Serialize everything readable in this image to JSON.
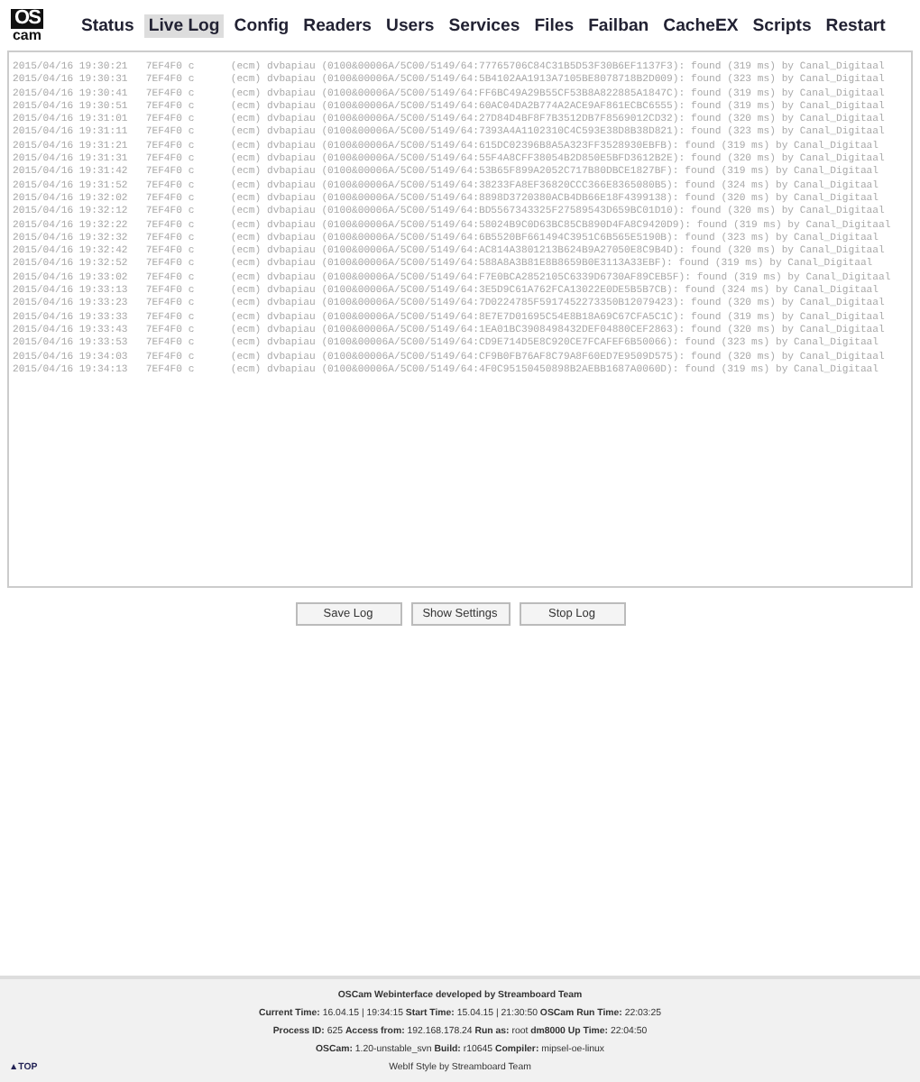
{
  "logo": {
    "top": "OS",
    "bottom": "cam"
  },
  "nav": [
    {
      "label": "Status",
      "selected": false
    },
    {
      "label": "Live Log",
      "selected": true
    },
    {
      "label": "Config",
      "selected": false
    },
    {
      "label": "Readers",
      "selected": false
    },
    {
      "label": "Users",
      "selected": false
    },
    {
      "label": "Services",
      "selected": false
    },
    {
      "label": "Files",
      "selected": false
    },
    {
      "label": "Failban",
      "selected": false
    },
    {
      "label": "CacheEX",
      "selected": false
    },
    {
      "label": "Scripts",
      "selected": false
    },
    {
      "label": "Restart",
      "selected": false
    }
  ],
  "log_lines": [
    "2015/04/16 19:30:21   7EF4F0 c      (ecm) dvbapiau (0100&00006A/5C00/5149/64:77765706C84C31B5D53F30B6EF1137F3): found (319 ms) by Canal_Digitaal",
    "2015/04/16 19:30:31   7EF4F0 c      (ecm) dvbapiau (0100&00006A/5C00/5149/64:5B4102AA1913A7105BE8078718B2D009): found (323 ms) by Canal_Digitaal",
    "2015/04/16 19:30:41   7EF4F0 c      (ecm) dvbapiau (0100&00006A/5C00/5149/64:FF6BC49A29B55CF53B8A822885A1847C): found (319 ms) by Canal_Digitaal",
    "2015/04/16 19:30:51   7EF4F0 c      (ecm) dvbapiau (0100&00006A/5C00/5149/64:60AC04DA2B774A2ACE9AF861ECBC6555): found (319 ms) by Canal_Digitaal",
    "2015/04/16 19:31:01   7EF4F0 c      (ecm) dvbapiau (0100&00006A/5C00/5149/64:27D84D4BF8F7B3512DB7F8569012CD32): found (320 ms) by Canal_Digitaal",
    "2015/04/16 19:31:11   7EF4F0 c      (ecm) dvbapiau (0100&00006A/5C00/5149/64:7393A4A1102310C4C593E38D8B38D821): found (323 ms) by Canal_Digitaal",
    "2015/04/16 19:31:21   7EF4F0 c      (ecm) dvbapiau (0100&00006A/5C00/5149/64:615DC02396B8A5A323FF3528930EBFB): found (319 ms) by Canal_Digitaal",
    "2015/04/16 19:31:31   7EF4F0 c      (ecm) dvbapiau (0100&00006A/5C00/5149/64:55F4A8CFF38054B2D850E5BFD3612B2E): found (320 ms) by Canal_Digitaal",
    "2015/04/16 19:31:42   7EF4F0 c      (ecm) dvbapiau (0100&00006A/5C00/5149/64:53B65F899A2052C717B80DBCE1827BF): found (319 ms) by Canal_Digitaal",
    "2015/04/16 19:31:52   7EF4F0 c      (ecm) dvbapiau (0100&00006A/5C00/5149/64:38233FA8EF36820CCC366E8365080B5): found (324 ms) by Canal_Digitaal",
    "2015/04/16 19:32:02   7EF4F0 c      (ecm) dvbapiau (0100&00006A/5C00/5149/64:8898D3720380ACB4DB66E18F4399138): found (320 ms) by Canal_Digitaal",
    "2015/04/16 19:32:12   7EF4F0 c      (ecm) dvbapiau (0100&00006A/5C00/5149/64:BD5567343325F27589543D659BC01D10): found (320 ms) by Canal_Digitaal",
    "2015/04/16 19:32:22   7EF4F0 c      (ecm) dvbapiau (0100&00006A/5C00/5149/64:58024B9C0D63BC85CB890D4FA8C9420D9): found (319 ms) by Canal_Digitaal",
    "2015/04/16 19:32:32   7EF4F0 c      (ecm) dvbapiau (0100&00006A/5C00/5149/64:6B5520BF661494C3951C6B565E5190B): found (323 ms) by Canal_Digitaal",
    "2015/04/16 19:32:42   7EF4F0 c      (ecm) dvbapiau (0100&00006A/5C00/5149/64:AC814A3801213B624B9A27050E8C9B4D): found (320 ms) by Canal_Digitaal",
    "2015/04/16 19:32:52   7EF4F0 c      (ecm) dvbapiau (0100&00006A/5C00/5149/64:588A8A3B81E8B8659B0E3113A33EBF): found (319 ms) by Canal_Digitaal",
    "2015/04/16 19:33:02   7EF4F0 c      (ecm) dvbapiau (0100&00006A/5C00/5149/64:F7E0BCA2852105C6339D6730AF89CEB5F): found (319 ms) by Canal_Digitaal",
    "2015/04/16 19:33:13   7EF4F0 c      (ecm) dvbapiau (0100&00006A/5C00/5149/64:3E5D9C61A762FCA13022E0DE5B5B7CB): found (324 ms) by Canal_Digitaal",
    "2015/04/16 19:33:23   7EF4F0 c      (ecm) dvbapiau (0100&00006A/5C00/5149/64:7D0224785F5917452273350B12079423): found (320 ms) by Canal_Digitaal",
    "2015/04/16 19:33:33   7EF4F0 c      (ecm) dvbapiau (0100&00006A/5C00/5149/64:8E7E7D01695C54E8B18A69C67CFA5C1C): found (319 ms) by Canal_Digitaal",
    "2015/04/16 19:33:43   7EF4F0 c      (ecm) dvbapiau (0100&00006A/5C00/5149/64:1EA01BC3908498432DEF04880CEF2863): found (320 ms) by Canal_Digitaal",
    "2015/04/16 19:33:53   7EF4F0 c      (ecm) dvbapiau (0100&00006A/5C00/5149/64:CD9E714D5E8C920CE7FCAFEF6B50066): found (323 ms) by Canal_Digitaal",
    "2015/04/16 19:34:03   7EF4F0 c      (ecm) dvbapiau (0100&00006A/5C00/5149/64:CF9B0FB76AF8C79A8F60ED7E9509D575): found (320 ms) by Canal_Digitaal",
    "2015/04/16 19:34:13   7EF4F0 c      (ecm) dvbapiau (0100&00006A/5C00/5149/64:4F0C95150450898B2AEBB1687A0060D): found (319 ms) by Canal_Digitaal"
  ],
  "buttons": [
    "Save Log",
    "Show Settings",
    "Stop Log"
  ],
  "footer": {
    "title": "OSCam Webinterface developed by Streamboard Team",
    "lines": [
      "**Current Time:** 16.04.15 | 19:34:15 **Start Time:** 15.04.15 | 21:30:50 **OSCam Run Time:** 22:03:25",
      "**Process ID:** 625 **Access from:** 192.168.178.24 **Run as:** root **dm8000 Up Time:** 22:04:50",
      "**OSCam:** 1.20-unstable_svn **Build:** r10645 **Compiler:** mipsel-oe-linux"
    ],
    "top_link": "▲TOP",
    "credit": "WebIf Style by Streamboard Team"
  }
}
